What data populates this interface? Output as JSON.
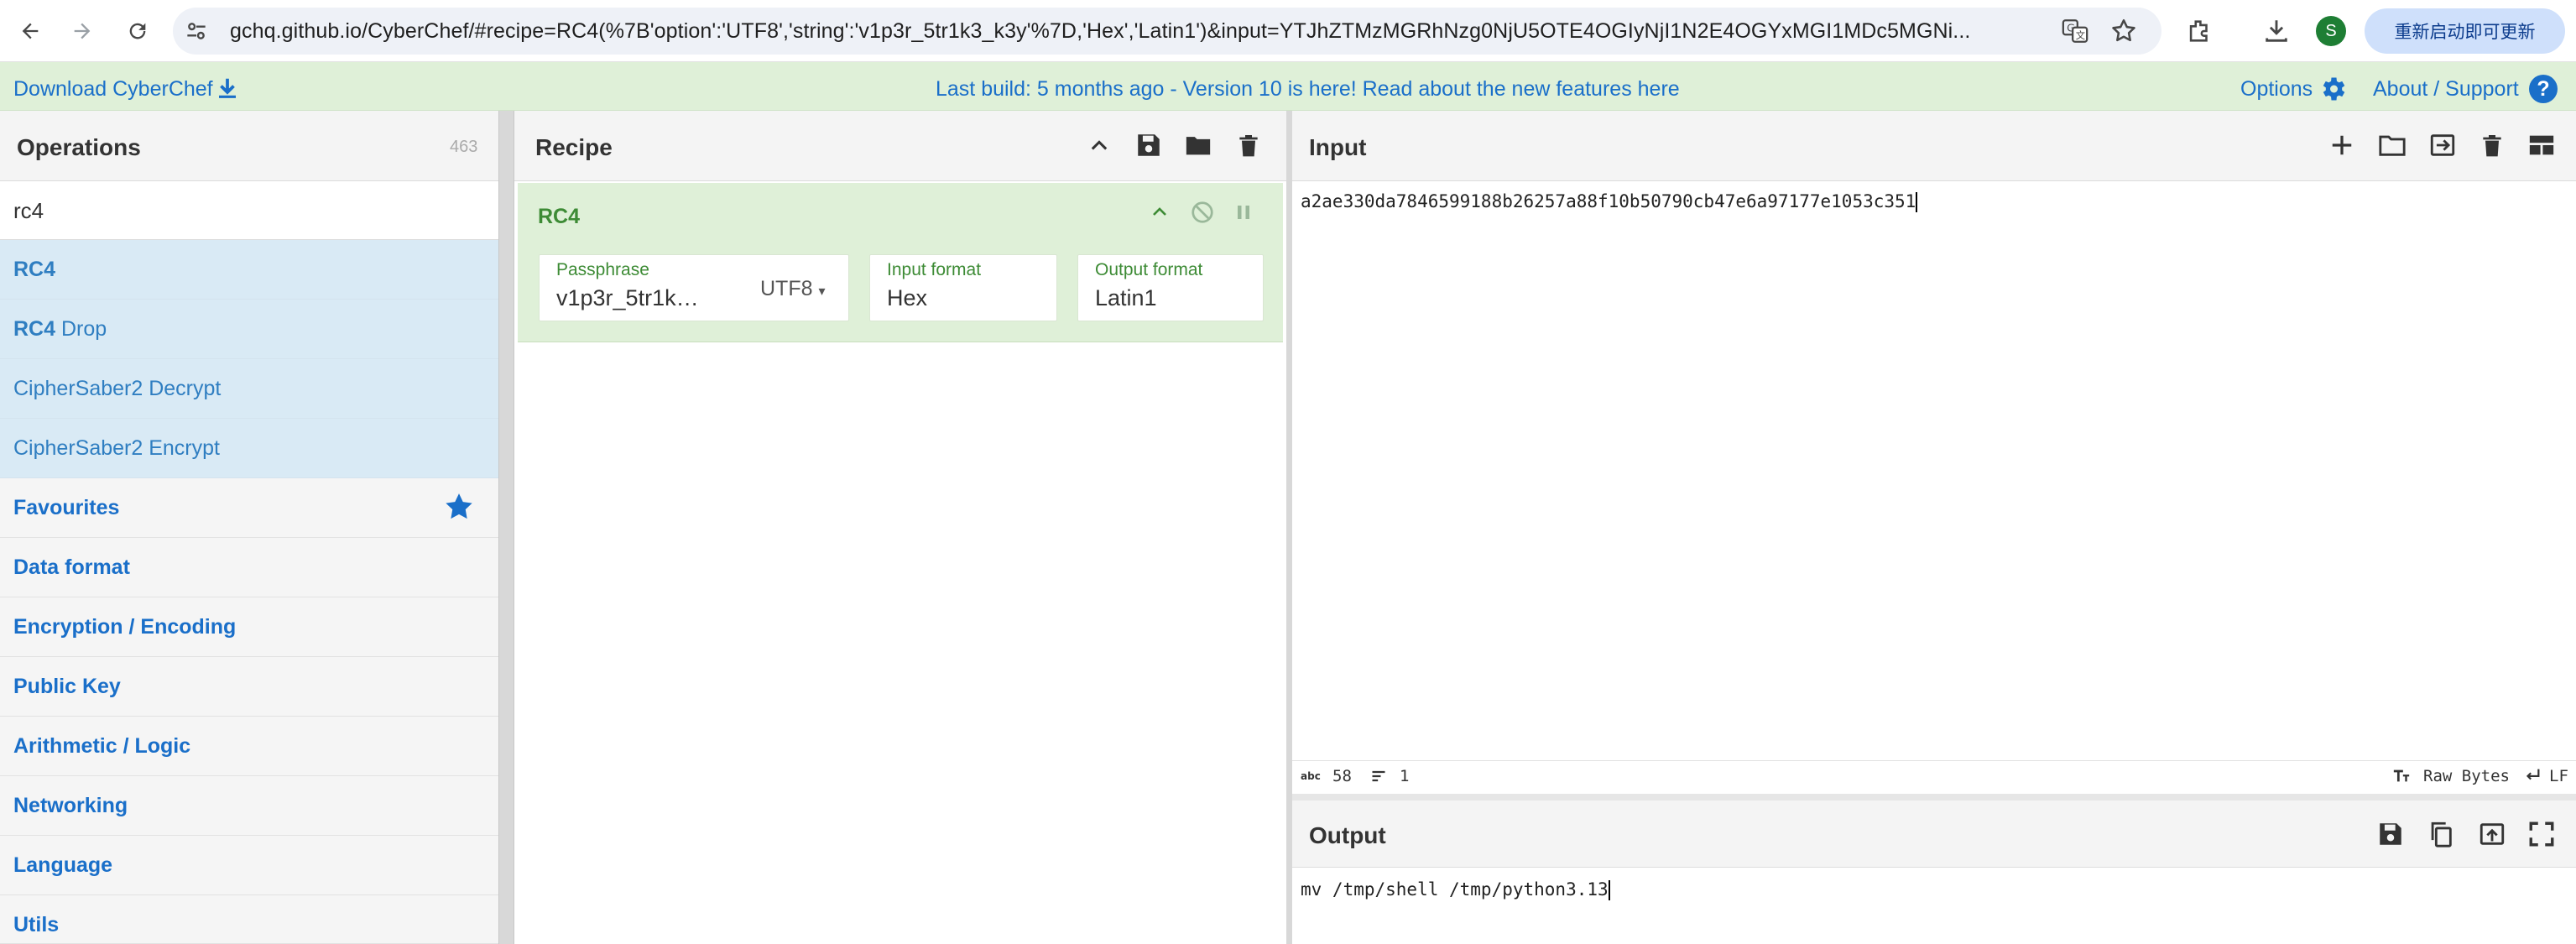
{
  "browser": {
    "url": "gchq.github.io/CyberChef/#recipe=RC4(%7B'option':'UTF8','string':'v1p3r_5tr1k3_k3y'%7D,'Hex','Latin1')&input=YTJhZTMzMGRhNzg0NjU5OTE4OGIyNjI1N2E4OGYxMGI1MDc5MGNi...",
    "update_button": "重新启动即可更新",
    "avatar_letter": "S"
  },
  "banner": {
    "download_label": "Download CyberChef",
    "build_info": "Last build: 5 months ago - Version 10 is here! Read about the new features here",
    "options_label": "Options",
    "about_label": "About / Support"
  },
  "operations": {
    "title": "Operations",
    "count": "463",
    "search_value": "rc4",
    "results": [
      {
        "bold": "RC4",
        "rest": ""
      },
      {
        "bold": "RC4",
        "rest": " Drop"
      },
      {
        "label": "CipherSaber2 Decrypt"
      },
      {
        "label": "CipherSaber2 Encrypt"
      }
    ],
    "categories": [
      "Favourites",
      "Data format",
      "Encryption / Encoding",
      "Public Key",
      "Arithmetic / Logic",
      "Networking",
      "Language",
      "Utils"
    ]
  },
  "recipe": {
    "title": "Recipe",
    "operation": {
      "name": "RC4",
      "passphrase_label": "Passphrase",
      "passphrase_value": "v1p3r_5tr1k…",
      "passphrase_encoding": "UTF8",
      "input_format_label": "Input format",
      "input_format_value": "Hex",
      "output_format_label": "Output format",
      "output_format_value": "Latin1"
    }
  },
  "input": {
    "title": "Input",
    "value": "a2ae330da7846599188b26257a88f10b50790cb47e6a97177e1053c351",
    "char_count": "58",
    "line_count": "1",
    "encoding": "Raw Bytes",
    "line_ending": "LF"
  },
  "output": {
    "title": "Output",
    "value": "mv /tmp/shell /tmp/python3.13"
  },
  "colors": {
    "banner_bg": "#dff0d8",
    "link_blue": "#1a6fc9",
    "op_highlight": "#d9eaf5",
    "recipe_op_bg": "#dff0d8",
    "recipe_op_text": "#3d8b35"
  }
}
